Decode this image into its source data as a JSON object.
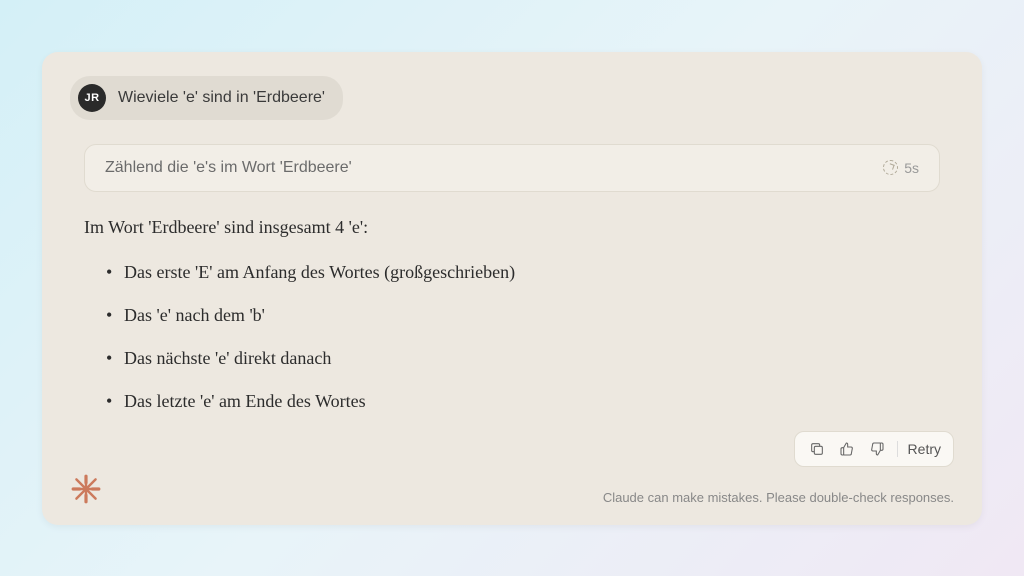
{
  "user": {
    "initials": "JR",
    "message": "Wieviele 'e' sind in 'Erdbeere'"
  },
  "thinking": {
    "summary": "Zählend die 'e's im Wort 'Erdbeere'",
    "duration": "5s"
  },
  "answer": {
    "intro": "Im Wort 'Erdbeere' sind insgesamt 4 'e':",
    "items": [
      "Das erste 'E' am Anfang des Wortes (großgeschrieben)",
      "Das 'e' nach dem 'b'",
      "Das nächste 'e' direkt danach",
      "Das letzte 'e' am Ende des Wortes"
    ]
  },
  "actions": {
    "retry": "Retry"
  },
  "disclaimer": "Claude can make mistakes. Please double-check responses."
}
